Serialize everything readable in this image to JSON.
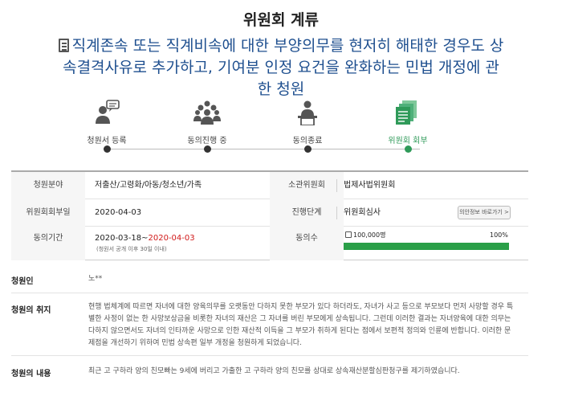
{
  "status_title": "위원회 계류",
  "petition": {
    "title": "직계존속 또는 직계비속에 대한 부양의무를 현저히 해태한 경우도 상속결격사유로 추가하고, 기여분 인정 요건을 완화하는 민법 개정에 관한 청원"
  },
  "steps": [
    {
      "label": "청원서 등록",
      "icon": "speech-person-icon",
      "active": false
    },
    {
      "label": "동의진행 중",
      "icon": "people-group-icon",
      "active": false
    },
    {
      "label": "동의종료",
      "icon": "podium-person-icon",
      "active": false
    },
    {
      "label": "위원회 회부",
      "icon": "document-stack-icon",
      "active": true
    }
  ],
  "info": {
    "field_label": "청원분야",
    "field_value": "저출산/고령화/아동/청소년/가족",
    "committee_label": "소관위원회",
    "committee_value": "법제사법위원회",
    "referral_date_label": "위원회회부일",
    "referral_date_value": "2020-04-03",
    "stage_label": "진행단계",
    "stage_value": "위원회심사",
    "result_button": "의안정보 바로가기 >",
    "period_label": "동의기간",
    "period_start": "2020-03-18~",
    "period_end": "2020-04-03",
    "period_note": "(청원서 공개 이후 30일 이내)",
    "agree_label": "동의수",
    "agree_count": "100,000명",
    "agree_percent_text": "100%",
    "agree_percent": 100
  },
  "sections": {
    "petitioner_label": "청원인",
    "petitioner_value": "노**",
    "purpose_label": "청원의 취지",
    "purpose_text": "현행 법체계에 따르면 자녀에 대한 양육의무를 오랫동안 다하지 못한 부모가 있다 하더라도, 자녀가 사고 등으로 부모보다 먼저 사망할 경우 특별한 사정이 없는 한 사망보상금을 비롯한 자녀의 재산은 그 자녀를 버린 부모에게 상속됩니다. 그런데 이러한 결과는 자녀양육에 대한 의무는 다하지 않으면서도 자녀의 인타까운 사망으로 인한 재산적 이득을 그 부모가 취하게 된다는 점에서 보편적 정의와 인륜에 반합니다. 이러한 문제점을 개선하기 위하여 민법 상속편 일부 개정을 청원하게 되었습니다.",
    "content_label": "청원의 내용",
    "content_text": "최근 고 구하라 양의 친모빠는 9세에 버리고 가출한 고 구하라 양의 친모를 상대로 상속재산분할심판청구를 제기하였습니다."
  },
  "colors": {
    "title_blue": "#1e4f8f",
    "accent_green": "#2f9a59",
    "progress_green": "#2a9f48",
    "date_red": "#d11a1a"
  }
}
